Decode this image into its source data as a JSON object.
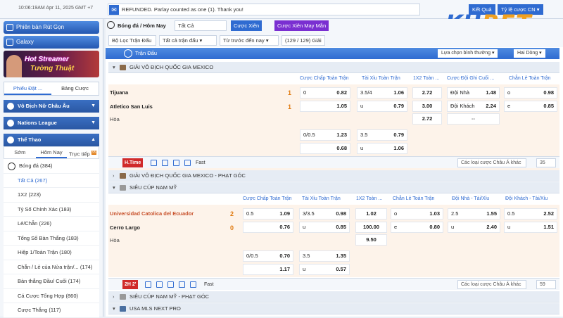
{
  "header": {
    "clock": "10:06:19AM Apr 11, 2025 GMT +7",
    "notice": "REFUNDED. Parlay counted as one (1). Thank you!",
    "results": "Kết Quả",
    "odds_type": "Tỷ lệ cược CN ▾"
  },
  "logo": {
    "text1": "KU",
    "text2": "BET"
  },
  "sidebar": {
    "promo1": "Phiên bản Rút Gọn",
    "promo2": "Galaxy",
    "banner": {
      "line1": "Hot Streamer",
      "line2": "Tường Thuật"
    },
    "tabs": [
      "Phiếu Đặt ...",
      "Bảng Cược"
    ],
    "sections": [
      "Vô Địch Nữ Châu Âu",
      "Nations League",
      "Thể Thao"
    ],
    "subtabs": [
      "Sớm",
      "Hôm Nay",
      "Trực tiếp"
    ],
    "subtab_badge": "95",
    "menu": [
      {
        "label": "Bóng đá",
        "count": "(384)"
      },
      {
        "label": "Tất Cả",
        "count": "(267)"
      },
      {
        "label": "1X2",
        "count": "(223)"
      },
      {
        "label": "Tỷ Số Chính Xác",
        "count": "(183)"
      },
      {
        "label": "Lẻ/Chẵn",
        "count": "(226)"
      },
      {
        "label": "Tổng Số Bàn Thắng",
        "count": "(183)"
      },
      {
        "label": "Hiệp 1/Toàn Trận",
        "count": "(180)"
      },
      {
        "label": "Chẵn / Lẻ của Nửa trận/...",
        "count": "(174)"
      },
      {
        "label": "Bàn thắng Đầu/ Cuối",
        "count": "(174)"
      },
      {
        "label": "Cá Cược Tổng Hợp",
        "count": "(860)"
      },
      {
        "label": "Cược Thắng",
        "count": "(117)"
      }
    ]
  },
  "filters": {
    "sport": "Bóng đá / Hôm Nay",
    "all": "Tất Cả",
    "parlay": "Cược Xiên",
    "lucky_parlay": "Cược Xiên May Mắn",
    "league_filter": "Bộ Lọc Trận Đấu ▾",
    "all_matches": "Tất cả trận đấu ▾",
    "from_now": "Từ trước đến nay ▾",
    "count": "(129 / 129) Giải"
  },
  "bar": {
    "title": "Trận Đấu",
    "sort": "Lựa chọn bình thường ▾",
    "lines": "Hai Dòng ▾"
  },
  "league1": {
    "name": "GIẢI VÔ ĐỊCH QUỐC GIA MEXICO",
    "headers": [
      "Cược Chấp Toàn Trận",
      "Tài Xỉu Toàn Trận",
      "1X2 Toàn ...",
      "Cược Đội Ghi Cuối ...",
      "Chẵn Lẻ Toàn Trận"
    ],
    "home": "Tijuana",
    "home_score": "1",
    "away": "Atletico San Luis",
    "away_score": "1",
    "draw": "Hòa",
    "r1": {
      "hc": "0",
      "hco": "0.82",
      "ou": "3.5/4",
      "ouo": "1.06",
      "x": "2.72",
      "lt": "Đội Nhà",
      "lto": "1.48",
      "oe": "o",
      "oeo": "0.98"
    },
    "r2": {
      "hco": "1.05",
      "ou": "u",
      "ouo": "0.79",
      "x": "3.00",
      "lt": "Đội Khách",
      "lto": "2.24",
      "oe": "e",
      "oeo": "0.85"
    },
    "r3": {
      "x": "2.72",
      "lt": "--"
    },
    "r4": {
      "hc": "0/0.5",
      "hco": "1.23",
      "ou": "3.5",
      "ouo": "0.79"
    },
    "r5": {
      "hco": "0.68",
      "ou": "u",
      "ouo": "1.06"
    },
    "foot": {
      "tag": "H.Time",
      "fast": "Fast",
      "other": "Các loại cược Châu Á khác",
      "num": "35"
    }
  },
  "league2": {
    "name": "GIẢI VÔ ĐỊCH QUỐC GIA MEXICO - PHẠT GÓC"
  },
  "league3": {
    "name": "SIÊU CÚP NAM MỸ",
    "headers": [
      "Cược Chấp Toàn Trận",
      "Tài Xỉu Toàn Trận",
      "1X2 Toàn ...",
      "Chẵn Lẻ Toàn Trận",
      "Đội Nhà - Tài/Xỉu",
      "Đội Khách - Tài/Xỉu"
    ],
    "home": "Universidad Catolica del Ecuador",
    "home_score": "2",
    "away": "Cerro Largo",
    "away_score": "0",
    "draw": "Hòa",
    "r1": {
      "hc": "0.5",
      "hco": "1.09",
      "ou": "3/3.5",
      "ouo": "0.98",
      "x": "1.02",
      "oe": "o",
      "oeo": "1.03",
      "h": "2.5",
      "ho": "1.55",
      "a": "0.5",
      "ao": "2.52"
    },
    "r2": {
      "hco": "0.76",
      "ou": "u",
      "ouo": "0.85",
      "x": "100.00",
      "oe": "e",
      "oeo": "0.80",
      "h": "u",
      "ho": "2.40",
      "a": "u",
      "ao": "1.51"
    },
    "r3": {
      "x": "9.50"
    },
    "r4": {
      "hc": "0/0.5",
      "hco": "0.70",
      "ou": "3.5",
      "ouo": "1.35"
    },
    "r5": {
      "hco": "1.17",
      "ou": "u",
      "ouo": "0.57"
    },
    "foot": {
      "tag": "2H 2'",
      "fast": "Fast",
      "other": "Các loại cược Châu Á khác",
      "num": "59"
    }
  },
  "league4": {
    "name": "SIÊU CÚP NAM MỸ - PHẠT GÓC"
  },
  "league5": {
    "name": "USA MLS NEXT PRO"
  }
}
